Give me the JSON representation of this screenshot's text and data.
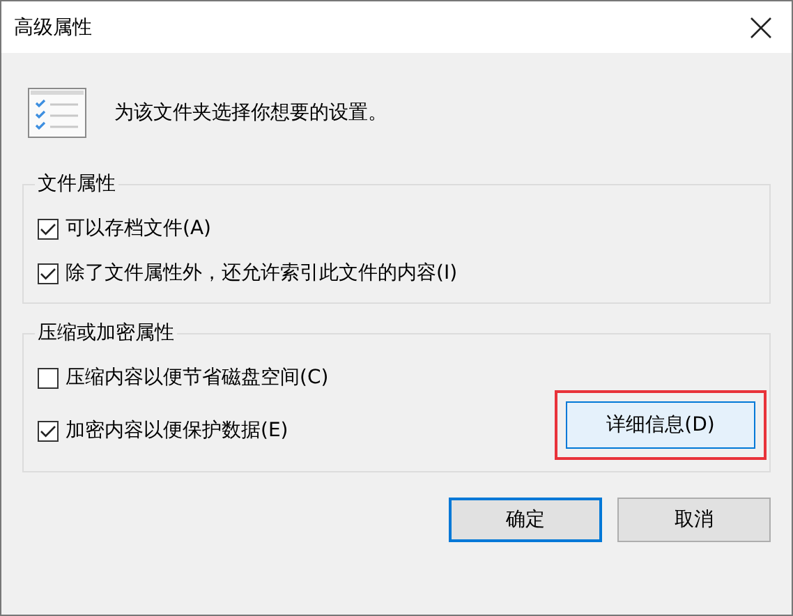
{
  "window": {
    "title": "高级属性"
  },
  "intro": "为该文件夹选择你想要的设置。",
  "groups": [
    {
      "legend": "文件属性",
      "options": [
        {
          "label": "可以存档文件(A)",
          "checked": true
        },
        {
          "label": "除了文件属性外，还允许索引此文件的内容(I)",
          "checked": true
        }
      ]
    },
    {
      "legend": "压缩或加密属性",
      "options": [
        {
          "label": "压缩内容以便节省磁盘空间(C)",
          "checked": false
        },
        {
          "label": "加密内容以便保护数据(E)",
          "checked": true
        }
      ],
      "button": {
        "label": "详细信息(D)",
        "highlighted": true
      }
    }
  ],
  "buttons": [
    {
      "label": "确定",
      "default": true
    },
    {
      "label": "取消",
      "default": false
    }
  ]
}
